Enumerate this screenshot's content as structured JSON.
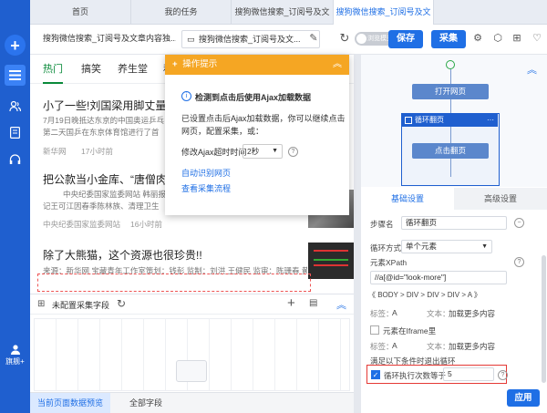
{
  "rail": {
    "user_label": "旗舰+"
  },
  "tabs": [
    {
      "label": "首页"
    },
    {
      "label": "我的任务"
    },
    {
      "label": "搜狗微信搜索_订阅号及文"
    },
    {
      "label": "搜狗微信搜索_订阅号及文"
    }
  ],
  "toolbar": {
    "task_name": "搜狗微信搜索_订阅号及文章内容独...",
    "page_url": "搜狗微信搜索_订阅号及文...",
    "mode_toggle": "浏览模式",
    "save_label": "保存",
    "collect_label": "采集"
  },
  "webview": {
    "nav": [
      "热门",
      "搞笑",
      "养生堂",
      "私"
    ],
    "articles": [
      {
        "title": "小了一些!刘国梁用脚丈量奥运",
        "body1": "7月19日晚抵达东京的中国奥运乒乓",
        "body2": "第二天国乒在东京体育馆进行了首",
        "source": "新华网",
        "time": "17小时前"
      },
      {
        "title": "把公款当小金库、“唐僧肉”?R",
        "body1": "中央纪委国家监委网站 韩丽报",
        "body2": "记王可江因春季陈林族、清理卫生",
        "source": "中央纪委国家监委网站",
        "time": "16小时前"
      },
      {
        "title": "除了大熊猫，这个资源也很珍贵!!",
        "body1": "来源：新华网 宝藏青年工作室策划：钱彭 监制：刘洪 王健民 监审：陈珊春 黄",
        "body2": "",
        "source": "",
        "time": ""
      }
    ]
  },
  "popup": {
    "title": "操作提示",
    "detected": "检测到点击后使用Ajax加载数据",
    "desc1": "已设置点击后Ajax加载数据，你可以继续点击",
    "desc2": "网页，配置采集，或：",
    "timeout_label": "修改Ajax超时时间",
    "timeout_value": "2秒",
    "link_auto": "自动识别网页",
    "link_flow": "查看采集流程"
  },
  "fields": {
    "title": "未配置采集字段"
  },
  "bottom_tabs": [
    "当前页面数据预览",
    "全部字段"
  ],
  "flow": {
    "node_open": "打开网页",
    "loop_title": "循环翻页",
    "node_click": "点击翻页"
  },
  "settings": {
    "tab_basic": "基础设置",
    "tab_advanced": "高级设置",
    "step_name_label": "步骤名",
    "step_name_value": "循环翻页",
    "loop_mode_label": "循环方式",
    "loop_mode_value": "单个元素",
    "xpath_label": "元素XPath",
    "xpath_value": "//a[@id=\"look-more\"]",
    "breadcrumb": "《  BODY  >  DIV  >  DIV  >  DIV  >  A  》",
    "tag_label": "标签：",
    "tag_value": "A",
    "text_label": "文本：",
    "text_value": "加载更多内容",
    "iframe_label": "元素在Iframe里",
    "tag2_value": "A",
    "text2_value": "加载更多内容",
    "exit_label": "满足以下条件时退出循环",
    "exit_cond": "循环执行次数等于",
    "exit_value": "5",
    "apply_label": "应用"
  }
}
